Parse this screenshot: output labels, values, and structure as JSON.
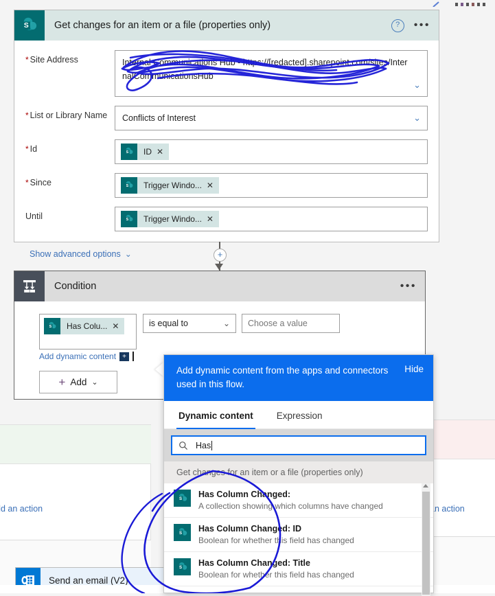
{
  "action_card": {
    "icon": "sharepoint-icon",
    "title": "Get changes for an item or a file (properties only)",
    "help": "?",
    "more": "•••",
    "fields": [
      {
        "label": "Site Address",
        "required": true,
        "value": "Internal Communications Hub - https://[redacted].sharepoint.com/sites/InternalCommunicationsHub",
        "type": "combobox",
        "chevron": "⌄"
      },
      {
        "label": "List or Library Name",
        "required": true,
        "value": "Conflicts of Interest",
        "type": "combobox",
        "chevron": "⌄"
      },
      {
        "label": "Id",
        "required": true,
        "type": "token",
        "token": "ID",
        "remove": "✕"
      },
      {
        "label": "Since",
        "required": true,
        "type": "token",
        "token": "Trigger Windo...",
        "remove": "✕"
      },
      {
        "label": "Until",
        "required": false,
        "type": "token",
        "token": "Trigger Windo...",
        "remove": "✕"
      }
    ],
    "advanced_label": "Show advanced options",
    "advanced_chevron": "⌄"
  },
  "connector": {
    "plus": "+"
  },
  "condition_card": {
    "icon": "condition-fork-icon",
    "title": "Condition",
    "more": "•••",
    "left_token": "Has Colu...",
    "left_remove": "✕",
    "operator": "is equal to",
    "operator_chevron": "⌄",
    "value_placeholder": "Choose a value",
    "add_dynamic_content": "Add dynamic content",
    "add_dynamic_badge": "+",
    "add_button": "Add",
    "add_button_plus": "+",
    "add_button_chevron": "⌄"
  },
  "branches": {
    "yes_add_action": "dd an action",
    "no_add_action": "an action",
    "email_card_title": "Send an email (V2)",
    "yes_color": "#eef6ee",
    "no_color": "#fbeeee"
  },
  "flyout": {
    "banner_text": "Add dynamic content from the apps and connectors used in this flow.",
    "hide_label": "Hide",
    "tabs": [
      {
        "label": "Dynamic content",
        "active": true
      },
      {
        "label": "Expression",
        "active": false
      }
    ],
    "search_value": "Has",
    "search_icon": "search-icon",
    "group_header": "Get changes for an item or a file (properties only)",
    "items": [
      {
        "title": "Has Column Changed:",
        "desc": "A collection showing which columns have changed"
      },
      {
        "title": "Has Column Changed: ID",
        "desc": "Boolean for whether this field has changed"
      },
      {
        "title": "Has Column Changed: Title",
        "desc": "Boolean for whether this field has changed"
      }
    ]
  },
  "colors": {
    "sharepoint_teal": "#036c70",
    "banner_blue": "#0b6ded",
    "link_blue": "#3a6fb7",
    "required_red": "#a80000",
    "ink_blue": "#1a1ad6"
  }
}
